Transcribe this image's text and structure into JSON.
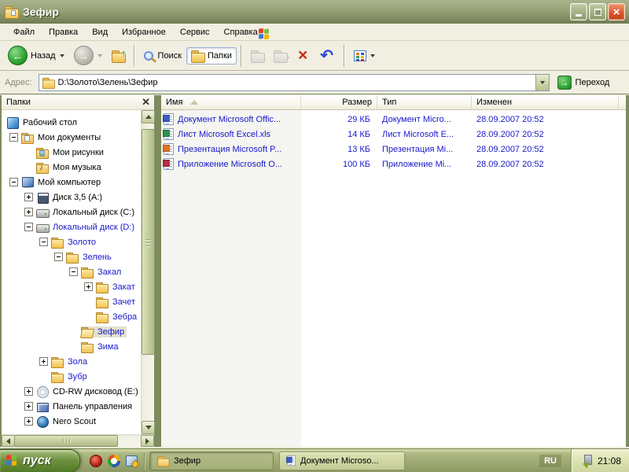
{
  "window": {
    "title": "Зефир",
    "theme_colors": {
      "titlebar": "#8A9668",
      "face": "#ECE9D8",
      "compressed_text": "#1818CC",
      "taskbar": "#9DA872"
    }
  },
  "menu": {
    "items": [
      "Файл",
      "Правка",
      "Вид",
      "Избранное",
      "Сервис",
      "Справка"
    ]
  },
  "toolbar": {
    "back_label": "Назад",
    "search_label": "Поиск",
    "folders_label": "Папки"
  },
  "address": {
    "label": "Адрес:",
    "value": "D:\\Золото\\Зелень\\Зефир",
    "go_label": "Переход"
  },
  "sidebar": {
    "title": "Папки",
    "tree": [
      {
        "label": "Рабочий стол"
      },
      {
        "label": "Мои документы"
      },
      {
        "label": "Мои рисунки"
      },
      {
        "label": "Моя музыка"
      },
      {
        "label": "Мой компьютер"
      },
      {
        "label": "Диск 3,5 (A:)"
      },
      {
        "label": "Локальный диск (C:)"
      },
      {
        "label": "Локальный диск (D:)"
      },
      {
        "label": "Золото"
      },
      {
        "label": "Зелень"
      },
      {
        "label": "Закал"
      },
      {
        "label": "Закат"
      },
      {
        "label": "Зачет"
      },
      {
        "label": "Зебра"
      },
      {
        "label": "Зефир"
      },
      {
        "label": "Зима"
      },
      {
        "label": "Зола"
      },
      {
        "label": "Зубр"
      },
      {
        "label": "CD-RW дисковод (E:)"
      },
      {
        "label": "Панель управления"
      },
      {
        "label": "Nero Scout"
      }
    ]
  },
  "main": {
    "columns": {
      "name": "Имя",
      "size": "Размер",
      "type": "Тип",
      "modified": "Изменен"
    },
    "files": [
      {
        "name": "Документ Microsoft Offic...",
        "size": "29 КБ",
        "type": "Документ Micro...",
        "modified": "28.09.2007 20:52"
      },
      {
        "name": "Лист Microsoft Excel.xls",
        "size": "14 КБ",
        "type": "Лист Microsoft E...",
        "modified": "28.09.2007 20:52"
      },
      {
        "name": "Презентация Microsoft P...",
        "size": "13 КБ",
        "type": "Презентация Mi...",
        "modified": "28.09.2007 20:52"
      },
      {
        "name": "Приложение Microsoft O...",
        "size": "100 КБ",
        "type": "Приложение Mi...",
        "modified": "28.09.2007 20:52"
      }
    ]
  },
  "taskbar": {
    "start_label": "пуск",
    "tasks": [
      "Зефир",
      "Документ Microso..."
    ],
    "language": "RU",
    "clock": "21:08"
  }
}
